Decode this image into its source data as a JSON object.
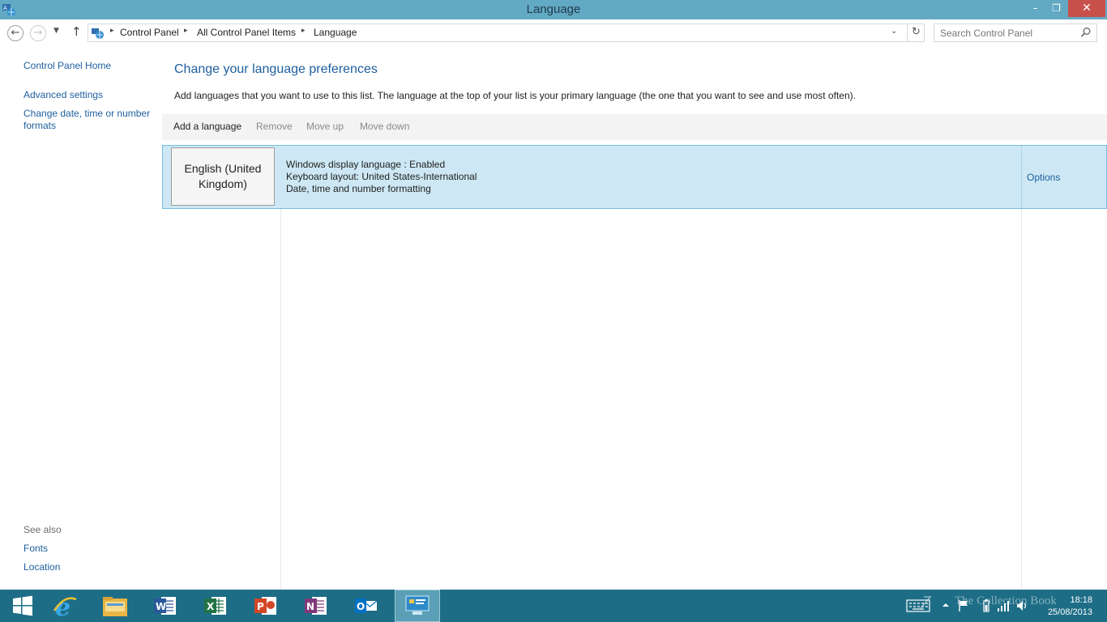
{
  "window": {
    "title": "Language",
    "minimize": "–",
    "maximize": "❐",
    "close": "✕"
  },
  "address": {
    "crumbs": [
      "Control Panel",
      "All Control Panel Items",
      "Language"
    ],
    "separator": "▸",
    "dropdown": "⌄",
    "refresh": "↻"
  },
  "nav": {
    "back": "←",
    "forward": "→",
    "recent": "▼",
    "up": "↑"
  },
  "search": {
    "placeholder": "Search Control Panel"
  },
  "sidebar": {
    "links": [
      "Control Panel Home",
      "Advanced settings",
      "Change date, time or number",
      "formats"
    ],
    "see_also_label": "See also",
    "see_also": [
      "Fonts",
      "Location"
    ]
  },
  "main": {
    "title": "Change your language preferences",
    "description": "Add languages that you want to use to this list. The language at the top of your list is your primary language (the one that you want to see and use most often).",
    "toolbar": [
      "Add a language",
      "Remove",
      "Move up",
      "Move down"
    ]
  },
  "languages": [
    {
      "name_line1": "English (United",
      "name_line2": "Kingdom)",
      "details": [
        "Windows display language : Enabled",
        "Keyboard layout: United States-International",
        "Date, time and number formatting"
      ],
      "options_label": "Options"
    }
  ],
  "taskbar": {
    "apps": [
      "start",
      "internet-explorer",
      "file-explorer",
      "word",
      "excel",
      "powerpoint",
      "onenote",
      "outlook",
      "control-panel"
    ],
    "watermark": "The Collection Book",
    "time": "18:18",
    "date": "25/08/2013"
  },
  "colors": {
    "titlebar": "#62a9c4",
    "link": "#1e5f9e",
    "selection": "#cde8f4",
    "taskbar": "#1e6d86"
  }
}
